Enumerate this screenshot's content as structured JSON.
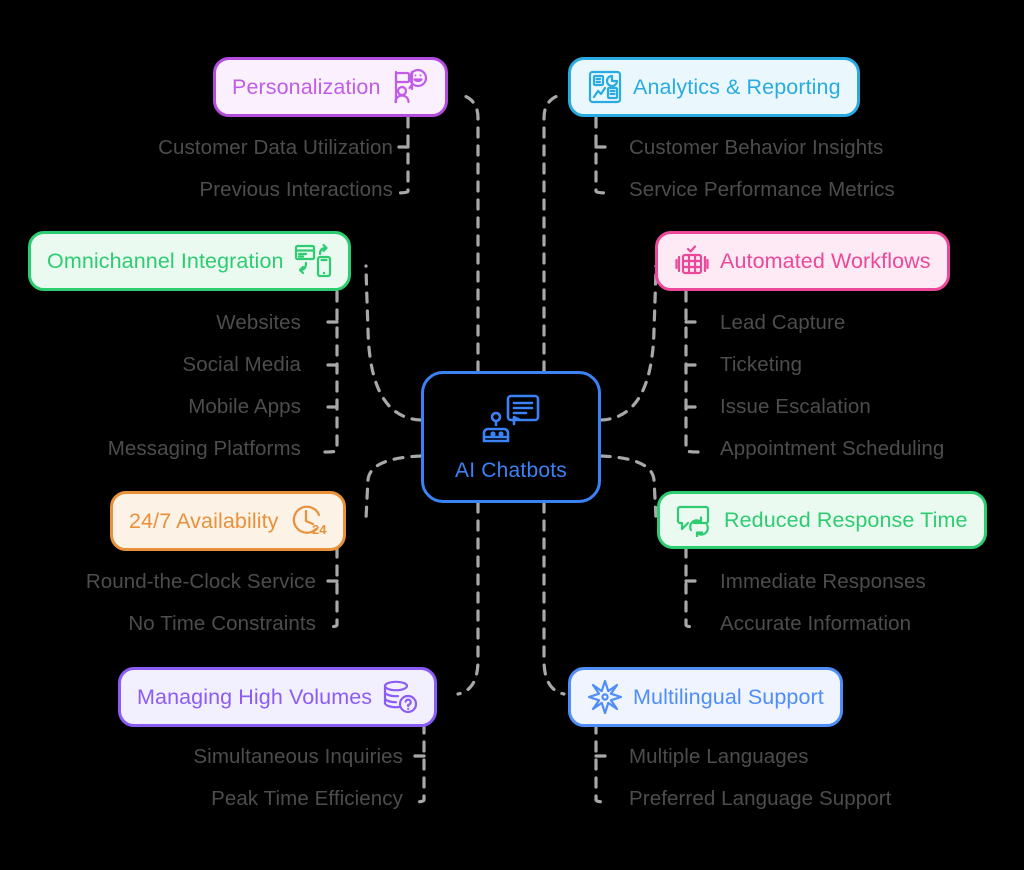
{
  "diagram": {
    "title": "AI Chatbots",
    "type": "mind-map",
    "background_color": "#000000",
    "connector_color": "#a8a8a8",
    "connector_style": "dashed"
  },
  "center": {
    "label": "AI Chatbots",
    "icon": "chatbot-speech-bubble-icon",
    "border_color": "#3b82f6",
    "text_color": "#3b82f6",
    "background_color": "#000000"
  },
  "branches": [
    {
      "id": "personalization",
      "label": "Personalization",
      "icon": "user-profile-smiley-icon",
      "side": "left",
      "border_color": "#b44ce0",
      "text_color": "#c05ce8",
      "background_color": "#fbf0fe",
      "children": [
        "Customer Data Utilization",
        "Previous Interactions"
      ]
    },
    {
      "id": "analytics-reporting",
      "label": "Analytics & Reporting",
      "icon": "analytics-report-chart-icon",
      "side": "right",
      "border_color": "#29abe2",
      "text_color": "#29abe2",
      "background_color": "#eaf8fd",
      "children": [
        "Customer Behavior Insights",
        "Service Performance Metrics"
      ]
    },
    {
      "id": "omnichannel-integration",
      "label": "Omnichannel Integration",
      "icon": "browser-mobile-sync-icon",
      "side": "left",
      "border_color": "#2ecc71",
      "text_color": "#2ecc71",
      "background_color": "#eafaf0",
      "children": [
        "Websites",
        "Social Media",
        "Mobile Apps",
        "Messaging Platforms"
      ]
    },
    {
      "id": "automated-workflows",
      "label": "Automated Workflows",
      "icon": "workflow-checklist-icon",
      "side": "right",
      "border_color": "#ec4899",
      "text_color": "#ec4899",
      "background_color": "#fdeaf4",
      "children": [
        "Lead Capture",
        "Ticketing",
        "Issue Escalation",
        "Appointment Scheduling"
      ]
    },
    {
      "id": "availability-24-7",
      "label": "24/7 Availability",
      "icon": "clock-24-icon",
      "side": "left",
      "border_color": "#e8913a",
      "text_color": "#e8913a",
      "background_color": "#fdf2e6",
      "children": [
        "Round-the-Clock Service",
        "No Time Constraints"
      ]
    },
    {
      "id": "reduced-response-time",
      "label": "Reduced Response Time",
      "icon": "speech-bubble-refresh-icon",
      "side": "right",
      "border_color": "#2ecc71",
      "text_color": "#2ecc71",
      "background_color": "#eafaf0",
      "children": [
        "Immediate Responses",
        "Accurate Information"
      ]
    },
    {
      "id": "managing-high-volumes",
      "label": "Managing High Volumes",
      "icon": "database-question-icon",
      "side": "left",
      "border_color": "#8b5cf6",
      "text_color": "#8b5cf6",
      "background_color": "#f2effe",
      "children": [
        "Simultaneous Inquiries",
        "Peak Time Efficiency"
      ]
    },
    {
      "id": "multilingual-support",
      "label": "Multilingual Support",
      "icon": "compass-star-icon",
      "side": "right",
      "border_color": "#4f8ef7",
      "text_color": "#4f8ef7",
      "background_color": "#eff4fe",
      "children": [
        "Multiple Languages",
        "Preferred Language Support"
      ]
    }
  ]
}
